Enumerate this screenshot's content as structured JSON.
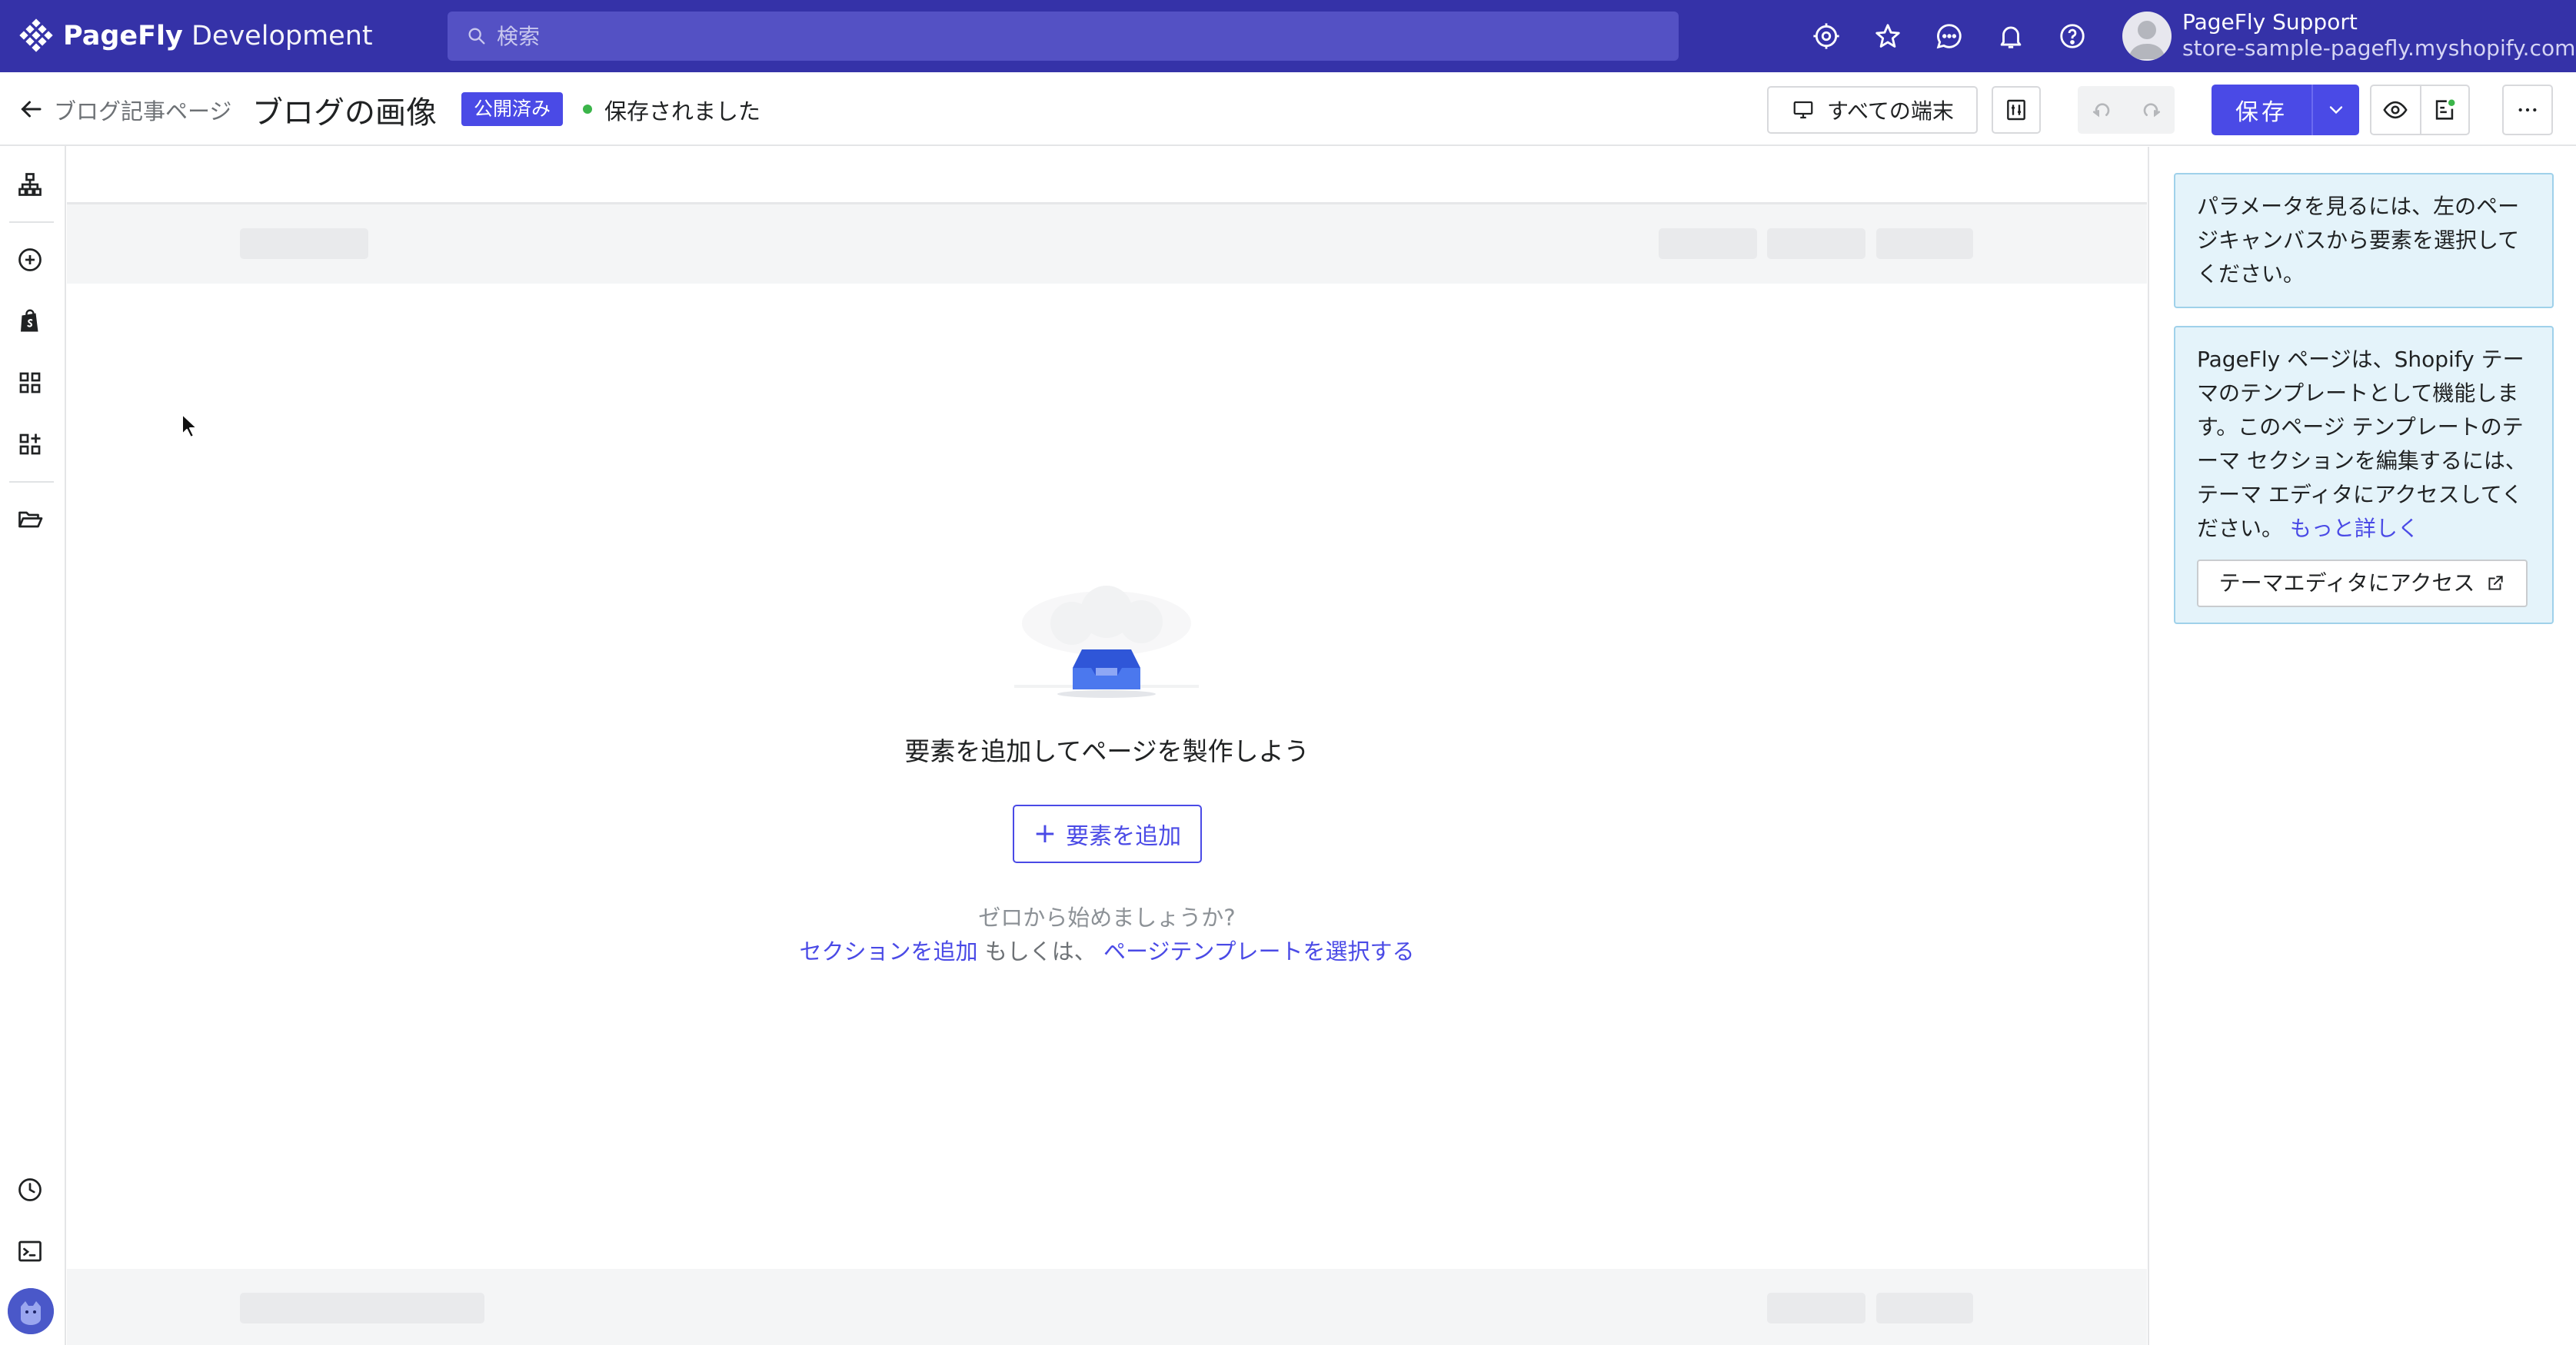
{
  "brand": {
    "name": "PageFly",
    "env": "Development"
  },
  "search": {
    "placeholder": "検索"
  },
  "user": {
    "name": "PageFly Support",
    "store": "store-sample-pagefly.myshopify.com"
  },
  "header": {
    "breadcrumb": "ブログ記事ページ",
    "title": "ブログの画像",
    "badge": "公開済み",
    "status": "保存されました",
    "device_label": "すべての端末",
    "save_label": "保存"
  },
  "canvas": {
    "empty_title": "要素を追加してページを製作しよう",
    "add_button": "要素を追加",
    "start_question": "ゼロから始めましょうか?",
    "add_section_link": "セクションを追加",
    "or_text": "もしくは、",
    "template_link": "ページテンプレートを選択する"
  },
  "panel": {
    "hint": "パラメータを見るには、左のページキャンバスから要素を選択してください。",
    "theme_info": "PageFly ページは、Shopify テーマのテンプレートとして機能します。このページ テンプレートのテーマ セクションを編集するには、テーマ エディタにアクセスしてください。",
    "learn_more": "もっと詳しく",
    "theme_button": "テーマエディタにアクセス"
  },
  "colors": {
    "topbar": "#3532a8",
    "accent": "#4a4ae6",
    "status_dot": "#3bb54a",
    "info_bg": "#e4f3fa",
    "info_border": "#9fd1ea"
  },
  "icons": {
    "topbar": [
      "target-icon",
      "star-icon",
      "chat-icon",
      "bell-icon",
      "help-icon"
    ],
    "sidebar": [
      "sitemap-icon",
      "add-circle-icon",
      "shopify-bag-icon",
      "grid-icon",
      "grid-add-icon",
      "folder-icon",
      "clock-icon",
      "terminal-icon"
    ]
  }
}
